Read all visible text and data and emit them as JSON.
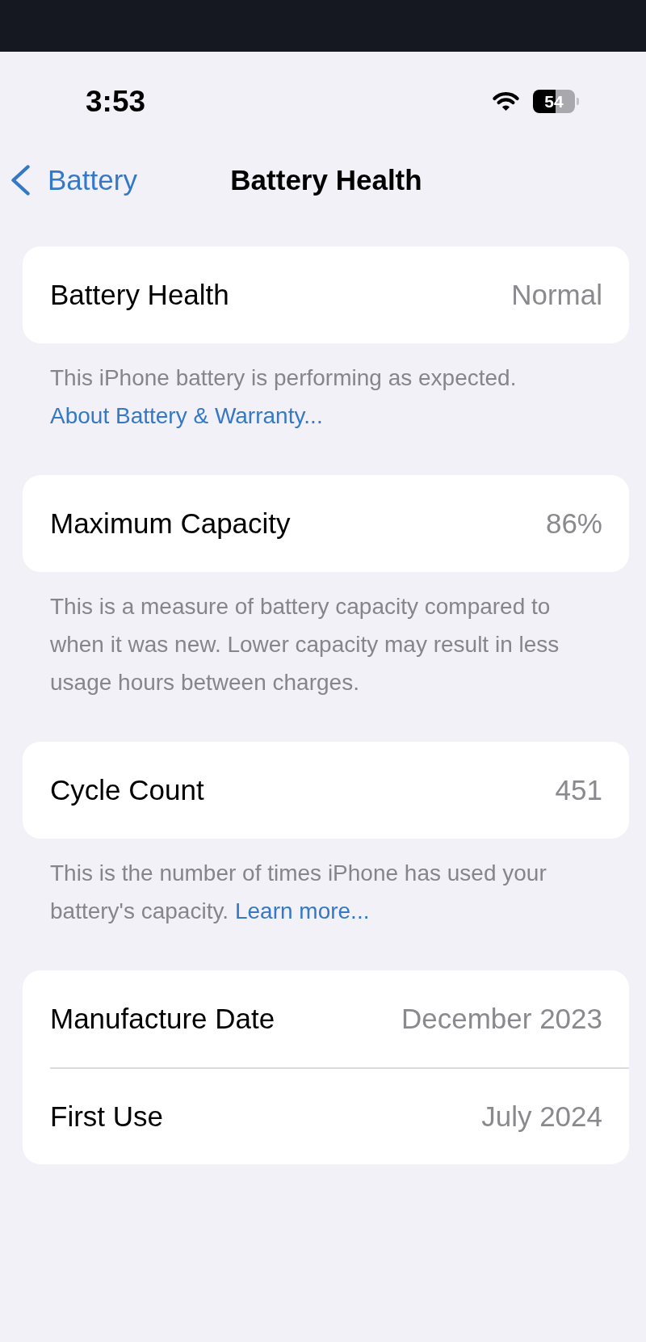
{
  "status_bar": {
    "time": "3:53",
    "battery_text": "54"
  },
  "nav": {
    "back_label": "Battery",
    "title": "Battery Health"
  },
  "sections": [
    {
      "rows": [
        {
          "label": "Battery Health",
          "value": "Normal"
        }
      ],
      "footer": {
        "text": "This iPhone battery is performing as expected.",
        "link": "About Battery & Warranty..."
      }
    },
    {
      "rows": [
        {
          "label": "Maximum Capacity",
          "value": "86%"
        }
      ],
      "footer": {
        "text": "This is a measure of battery capacity compared to when it was new. Lower capacity may result in less usage hours between charges."
      }
    },
    {
      "rows": [
        {
          "label": "Cycle Count",
          "value": "451"
        }
      ],
      "footer": {
        "text": "This is the number of times iPhone has used your battery's capacity.",
        "link": "Learn more..."
      }
    },
    {
      "rows": [
        {
          "label": "Manufacture Date",
          "value": "December 2023"
        },
        {
          "label": "First Use",
          "value": "July 2024"
        }
      ]
    }
  ]
}
